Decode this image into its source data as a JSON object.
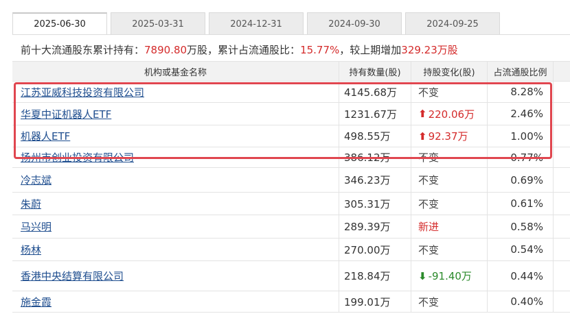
{
  "tabs": [
    {
      "label": "2025-06-30",
      "active": true
    },
    {
      "label": "2025-03-31",
      "active": false
    },
    {
      "label": "2024-12-31",
      "active": false
    },
    {
      "label": "2024-09-30",
      "active": false
    },
    {
      "label": "2024-09-25",
      "active": false
    }
  ],
  "summary": {
    "prefix": "前十大流通股东累计持有：",
    "shares": "7890.80",
    "shares_unit": "万股，累计占流通股比：",
    "ratio": "15.77%",
    "mid": "，较上期增加",
    "increase": "329.23",
    "increase_unit": "万股"
  },
  "table": {
    "headers": [
      "机构或基金名称",
      "持有数量(股)",
      "持股变化(股)",
      "占流通股比例"
    ],
    "rows": [
      {
        "name": "江苏亚威科技投资有限公司",
        "holding": "4145.68万",
        "change": "不变",
        "change_type": "same",
        "ratio": "8.28%"
      },
      {
        "name": "华夏中证机器人ETF",
        "holding": "1231.67万",
        "change": "220.06万",
        "change_type": "up",
        "ratio": "2.46%"
      },
      {
        "name": "机器人ETF",
        "holding": "498.55万",
        "change": "92.37万",
        "change_type": "up",
        "ratio": "1.00%"
      },
      {
        "name": "扬州市创业投资有限公司",
        "holding": "386.12万",
        "change": "不变",
        "change_type": "same",
        "ratio": "0.77%"
      },
      {
        "name": "冷志斌",
        "holding": "346.23万",
        "change": "不变",
        "change_type": "same",
        "ratio": "0.69%"
      },
      {
        "name": "朱蔚",
        "holding": "305.31万",
        "change": "不变",
        "change_type": "same",
        "ratio": "0.61%"
      },
      {
        "name": "马兴明",
        "holding": "289.39万",
        "change": "新进",
        "change_type": "new",
        "ratio": "0.58%"
      },
      {
        "name": "杨林",
        "holding": "270.00万",
        "change": "不变",
        "change_type": "same",
        "ratio": "0.54%"
      },
      {
        "name": "香港中央结算有限公司",
        "holding": "218.84万",
        "change": "-91.40万",
        "change_type": "down",
        "ratio": "0.44%"
      },
      {
        "name": "施金霞",
        "holding": "199.01万",
        "change": "不变",
        "change_type": "same",
        "ratio": "0.40%"
      }
    ]
  },
  "colors": {
    "accent_red": "#d42b2b",
    "accent_green": "#2b8a2b",
    "link_blue": "#1f4e8f",
    "highlight_border": "#e0464f"
  },
  "icons": {
    "up": "arrow-up-icon",
    "down": "arrow-down-icon"
  }
}
